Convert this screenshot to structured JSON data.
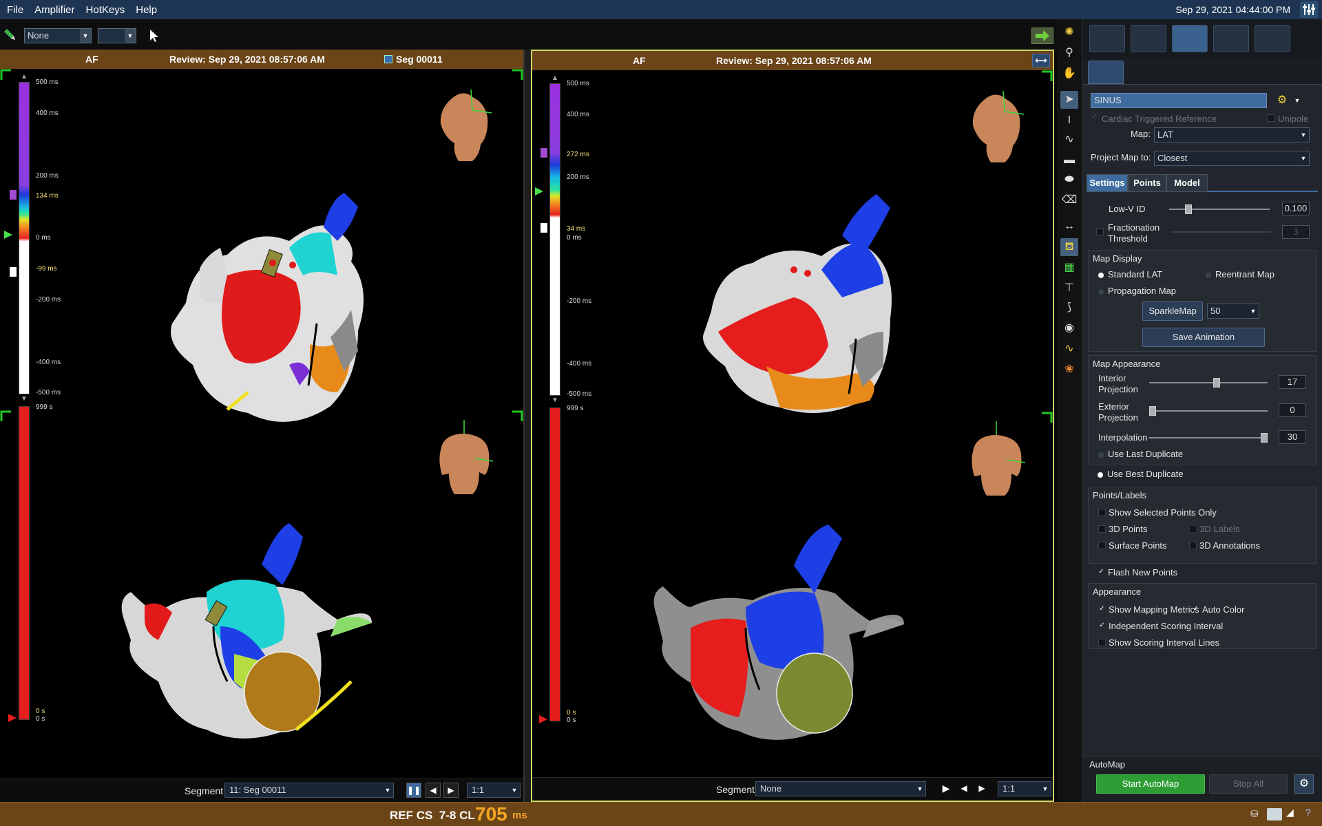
{
  "menu": {
    "items": [
      "File",
      "Amplifier",
      "HotKeys",
      "Help"
    ],
    "datetime": "Sep 29, 2021 04:44:00 PM"
  },
  "toolbar": {
    "select1": "None",
    "select2": ""
  },
  "left_pane": {
    "rhythm": "AF",
    "review": "Review: Sep 29, 2021 08:57:06 AM",
    "segment_tag": "Seg 00011",
    "scale": {
      "top": [
        "500 ms",
        "400 ms",
        "200 ms",
        "134 ms",
        "0 ms",
        "-99 ms",
        "-200 ms",
        "-400 ms",
        "-500 ms"
      ],
      "bottom": [
        "999 s",
        "0 s",
        "0 s"
      ]
    },
    "footer": {
      "segment_label": "Segment",
      "segment_value": "11: Seg 00011",
      "ratio": "1:1"
    }
  },
  "right_pane": {
    "rhythm": "AF",
    "review": "Review: Sep 29, 2021 08:57:06 AM",
    "scale": {
      "top": [
        "500 ms",
        "400 ms",
        "272 ms",
        "200 ms",
        "34 ms",
        "0 ms",
        "-200 ms",
        "-400 ms",
        "-500 ms"
      ],
      "bottom": [
        "999 s",
        "0 s",
        "0 s"
      ]
    },
    "footer": {
      "segment_label": "Segment",
      "segment_value": "None",
      "ratio": "1:1"
    }
  },
  "sidebar": {
    "map_name": "SINUS",
    "cardiac_triggered": "Cardiac Triggered Reference",
    "unipole": "Unipole",
    "map_label": "Map:",
    "map_value": "LAT",
    "project_label": "Project Map to:",
    "project_value": "Closest",
    "tabs": [
      "Settings",
      "Points",
      "Model"
    ],
    "low_v_label": "Low-V ID",
    "low_v_value": "0.100",
    "low_v_level": 0.2,
    "fractionation_label": "Fractionation Threshold",
    "fractionation_value": "3",
    "map_display": {
      "title": "Map Display",
      "standard_lat": "Standard LAT",
      "reentrant": "Reentrant Map",
      "propagation": "Propagation Map",
      "sparklemap": "SparkleMap",
      "sparklemap_value": "50",
      "save_animation": "Save Animation"
    },
    "map_appearance": {
      "title": "Map Appearance",
      "interior_label": "Interior Projection",
      "interior_value": "17",
      "exterior_label": "Exterior Projection",
      "exterior_value": "0",
      "interpolation_label": "Interpolation",
      "interpolation_value": "30",
      "use_last": "Use Last Duplicate",
      "use_best": "Use Best Duplicate"
    },
    "points_labels": {
      "title": "Points/Labels",
      "show_selected": "Show Selected Points Only",
      "points_3d": "3D Points",
      "labels_3d": "3D Labels",
      "surface_points": "Surface Points",
      "annotations_3d": "3D Annotations",
      "flash_new": "Flash New Points"
    },
    "appearance": {
      "title": "Appearance",
      "show_metrics": "Show Mapping Metrics",
      "auto_color": "Auto Color",
      "independent_scoring": "Independent Scoring Interval",
      "show_scoring_lines": "Show Scoring Interval Lines"
    },
    "automap": {
      "title": "AutoMap",
      "start": "Start AutoMap",
      "stop": "Stop All"
    }
  },
  "status": {
    "ref": "REF CS  7-8 CL",
    "cl_value": "705",
    "cl_unit": "ms"
  },
  "colors": {
    "accent": "#3d6b9e",
    "pane_header": "#6b4418",
    "automap_green": "#2e9d35",
    "cl_orange": "#f5a623"
  }
}
